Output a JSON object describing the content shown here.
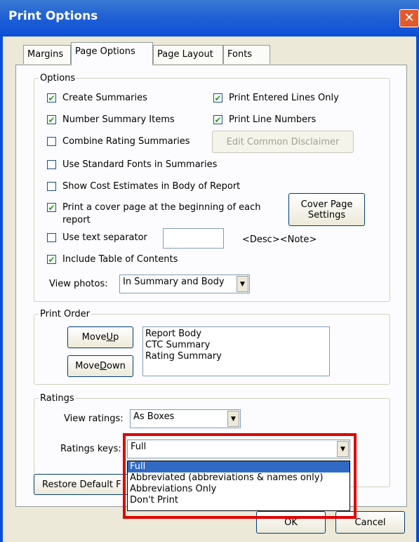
{
  "window": {
    "title": "Print Options",
    "close_icon": "✕"
  },
  "tabs": [
    "Margins",
    "Page Options",
    "Page Layout",
    "Fonts"
  ],
  "options": {
    "legend": "Options",
    "create_summaries": {
      "label": "Create Summaries",
      "checked": true
    },
    "print_entered_lines_only": {
      "label": "Print Entered Lines Only",
      "checked": true
    },
    "number_summary_items": {
      "label": "Number Summary Items",
      "checked": true
    },
    "print_line_numbers": {
      "label": "Print Line Numbers",
      "checked": true
    },
    "combine_rating_summaries": {
      "label": "Combine Rating Summaries",
      "checked": false
    },
    "edit_common_disclaimer": "Edit Common Disclaimer",
    "use_standard_fonts": {
      "label": "Use Standard Fonts in Summaries",
      "checked": false
    },
    "show_cost_estimates": {
      "label": "Show Cost Estimates in Body of Report",
      "checked": false
    },
    "print_cover_page": {
      "label": "Print a cover page at the beginning of each report",
      "checked": true
    },
    "cover_page_settings": "Cover Page Settings",
    "use_text_separator": {
      "label": "Use text separator",
      "checked": false
    },
    "separator_value": "",
    "desc_note": "<Desc><Note>",
    "include_toc": {
      "label": "Include Table of Contents",
      "checked": true
    },
    "view_photos_label": "View photos:",
    "view_photos_value": "In Summary and Body"
  },
  "print_order": {
    "legend": "Print Order",
    "move_up_pre": "Move ",
    "move_up_key": "U",
    "move_up_post": "p",
    "move_down_pre": "Move ",
    "move_down_key": "D",
    "move_down_post": "own",
    "items": [
      "Report Body",
      "CTC Summary",
      "Rating Summary"
    ]
  },
  "ratings": {
    "legend": "Ratings",
    "view_ratings_label": "View ratings:",
    "view_ratings_value": "As Boxes",
    "ratings_keys_label": "Ratings keys:",
    "ratings_keys_value": "Full",
    "dropdown_options": [
      "Full",
      "Abbreviated (abbreviations & names only)",
      "Abbreviations Only",
      "Don't Print"
    ],
    "dropdown_selected": 0
  },
  "footer": {
    "restore_default": "Restore Default F",
    "ok": "OK",
    "cancel": "Cancel"
  },
  "colors": {
    "highlight": "#e00000",
    "titlebar": "#0b4fd8",
    "check": "#21a121"
  }
}
